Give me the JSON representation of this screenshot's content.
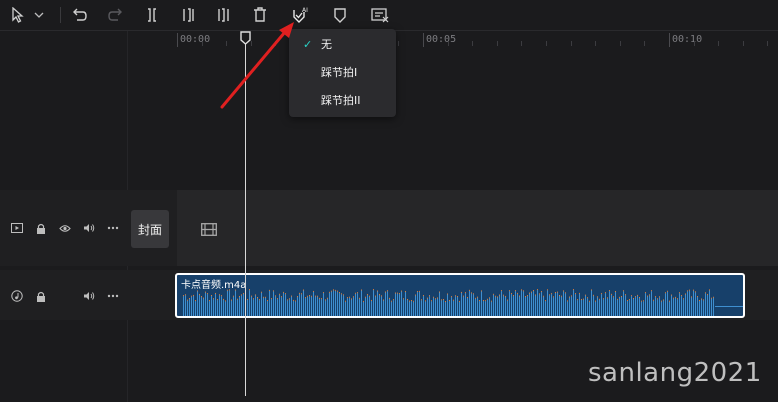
{
  "toolbar": {
    "icons": [
      "select-pointer-icon",
      "chevron-down-icon",
      "undo-icon",
      "redo-icon",
      "split-icon",
      "split-left-icon",
      "split-right-icon",
      "delete-icon",
      "ai-beat-icon",
      "marker-icon",
      "subtitle-edit-icon"
    ]
  },
  "ruler": {
    "labels": [
      "00:00",
      "00:05",
      "00:10"
    ]
  },
  "beat_menu": {
    "items": [
      {
        "label": "无",
        "checked": true
      },
      {
        "label": "踩节拍I",
        "checked": false
      },
      {
        "label": "踩节拍II",
        "checked": false
      }
    ],
    "check_mark": "✓"
  },
  "video_track": {
    "cover_label": "封面"
  },
  "audio_track": {
    "clip_name": "卡点音频.m4a"
  },
  "watermark": "sanlang2021",
  "colors": {
    "accent_teal": "#2ad4c8",
    "clip_blue": "#17406a",
    "annotation_red": "#e02020"
  }
}
